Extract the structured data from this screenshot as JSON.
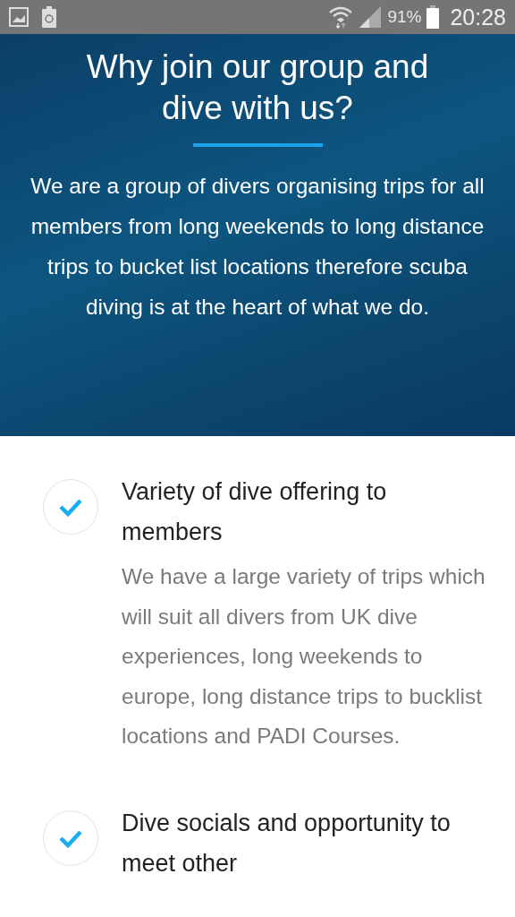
{
  "status_bar": {
    "battery": "91%",
    "time": "20:28"
  },
  "hero": {
    "title": "Why join our group and dive with us?",
    "text": "We are a group of divers organising trips for all members from long weekends to long distance trips to bucket list locations therefore scuba diving is at the heart of what we do."
  },
  "features": [
    {
      "title": "Variety of dive offering to members",
      "description": "We have a large variety of trips which will suit all divers from UK dive experiences, long weekends to europe, long distance trips to bucklist locations and PADI Courses."
    },
    {
      "title": "Dive socials and opportunity to meet other"
    }
  ]
}
